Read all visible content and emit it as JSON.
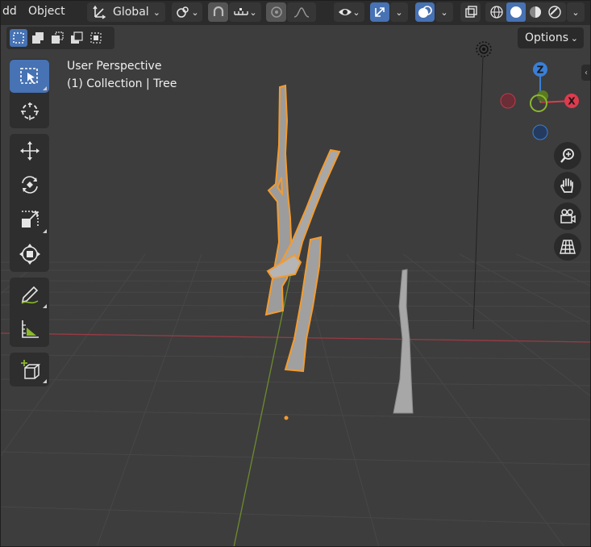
{
  "header": {
    "menu_partial": "dd",
    "menu_object": "Object",
    "orientation": "Global"
  },
  "options_label": "Options",
  "viewport": {
    "info_line1": "User Perspective",
    "info_line2": "(1) Collection | Tree"
  },
  "gizmo": {
    "z": "Z",
    "x": "X"
  },
  "colors": {
    "accent": "#4772b3",
    "selection": "#f39b2f",
    "x_axis": "#dd3b4e",
    "y_axis": "#8ab82c",
    "z_axis": "#3a7fd6"
  },
  "icons": {
    "tools": [
      "select-box-icon",
      "cursor-icon",
      "move-icon",
      "rotate-icon",
      "scale-icon",
      "transform-icon",
      "annotate-icon",
      "measure-icon",
      "add-cube-icon"
    ],
    "nav": [
      "zoom-icon",
      "hand-icon",
      "camera-icon",
      "grid-icon"
    ]
  }
}
